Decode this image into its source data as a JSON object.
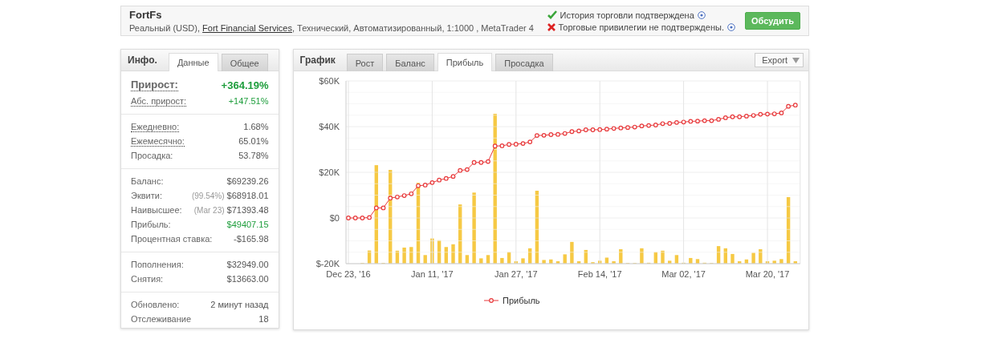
{
  "header": {
    "title": "FortFs",
    "description_prefix": "Реальный (USD), ",
    "broker_link": "Fort Financial Services",
    "description_suffix": ", Технический, Автоматизированный, 1:1000 , MetaTrader 4",
    "statuses": [
      {
        "text": "История торговли подтверждена",
        "verified": true
      },
      {
        "text": "Торговые привилегии не подтверждены.",
        "verified": false
      }
    ],
    "button": "Обсудить"
  },
  "info": {
    "label": "Инфо.",
    "tabs": [
      {
        "label": "Данные",
        "selected": true
      },
      {
        "label": "Общее",
        "selected": false
      }
    ],
    "groups": [
      [
        {
          "label": "Прирост:",
          "value": "+364.19%",
          "dotted": true,
          "kind": "headline",
          "color": "#1f9e3d"
        },
        {
          "label": "Абс. прирост:",
          "value": "+147.51%",
          "dotted": true,
          "color": "#1f9e3d"
        }
      ],
      [
        {
          "label": "Ежедневно:",
          "value": "1.68%",
          "dotted": true
        },
        {
          "label": "Ежемесячно:",
          "value": "65.01%",
          "dotted": true
        },
        {
          "label": "Просадка:",
          "value": "53.78%",
          "dotted": false
        }
      ],
      [
        {
          "label": "Баланс:",
          "value": "$69239.26",
          "dotted": false
        },
        {
          "label": "Эквити:",
          "note": "(99.54%)",
          "value": "$68918.01",
          "dotted": false
        },
        {
          "label": "Наивысшее:",
          "note": "(Mar 23)",
          "value": "$71393.48",
          "dotted": false
        },
        {
          "label": "Прибыль:",
          "value": "$49407.15",
          "dotted": false,
          "color": "#1f9e3d"
        },
        {
          "label": "Процентная ставка:",
          "value": "-$165.98",
          "dotted": false
        }
      ],
      [
        {
          "label": "Пополнения:",
          "value": "$32949.00",
          "dotted": false
        },
        {
          "label": "Снятия:",
          "value": "$13663.00",
          "dotted": false
        }
      ],
      [
        {
          "label": "Обновлено:",
          "value": "2 минут назад",
          "dotted": false
        },
        {
          "label": "Отслеживание",
          "value": "18",
          "dotted": false
        }
      ]
    ]
  },
  "chart_panel": {
    "label": "График",
    "tabs": [
      {
        "label": "Рост",
        "selected": false
      },
      {
        "label": "Баланс",
        "selected": false
      },
      {
        "label": "Прибыль",
        "selected": true
      },
      {
        "label": "Просадка",
        "selected": false
      }
    ],
    "export": "Export",
    "chart_data": {
      "type": "line",
      "grid": true,
      "categories": [
        "Dec 23, '16",
        null,
        null,
        null,
        null,
        null,
        null,
        null,
        null,
        null,
        null,
        null,
        "Jan 11, '17",
        null,
        null,
        null,
        null,
        null,
        null,
        null,
        null,
        null,
        null,
        null,
        "Jan 27, '17",
        null,
        null,
        null,
        null,
        null,
        null,
        null,
        null,
        null,
        null,
        null,
        "Feb 14, '17",
        null,
        null,
        null,
        null,
        null,
        null,
        null,
        null,
        null,
        null,
        null,
        "Mar 02, '17",
        null,
        null,
        null,
        null,
        null,
        null,
        null,
        null,
        null,
        null,
        null,
        "Mar 20, '17",
        null,
        null,
        null,
        null
      ],
      "ylim": [
        -20000,
        60000
      ],
      "yticks": [
        {
          "value": -20000,
          "label": "$-20K"
        },
        {
          "value": 0,
          "label": "$0"
        },
        {
          "value": 20000,
          "label": "$20K"
        },
        {
          "value": 40000,
          "label": "$40K"
        },
        {
          "value": 60000,
          "label": "$60K"
        }
      ],
      "series": [
        {
          "name": "Прибыль",
          "marker": "o",
          "color": "#e8393b",
          "values": [
            0,
            0,
            0,
            200,
            4400,
            4400,
            8700,
            9200,
            9800,
            10600,
            14100,
            14400,
            15500,
            16600,
            17300,
            18200,
            20800,
            21200,
            24300,
            24300,
            24700,
            31500,
            31600,
            32200,
            32300,
            32600,
            33300,
            36100,
            36200,
            36500,
            36600,
            37000,
            37800,
            38100,
            38600,
            38600,
            38700,
            38900,
            39200,
            39400,
            39600,
            39800,
            40300,
            40500,
            40700,
            41300,
            41400,
            41800,
            42000,
            42300,
            42400,
            42600,
            42600,
            43200,
            43900,
            44300,
            44300,
            44600,
            44900,
            45400,
            45500,
            45600,
            46000,
            48900,
            49400
          ]
        }
      ]
    }
  }
}
